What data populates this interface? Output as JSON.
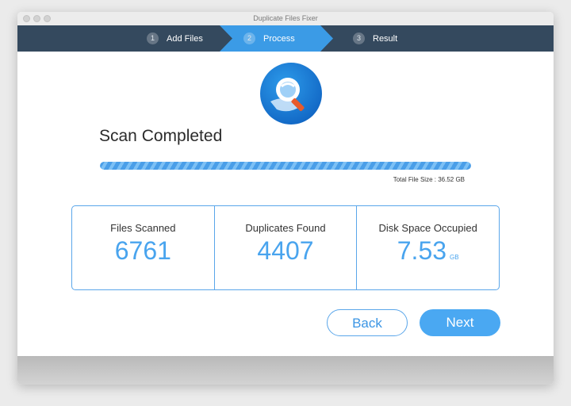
{
  "window": {
    "title": "Duplicate Files Fixer"
  },
  "steps": [
    {
      "num": "1",
      "label": "Add Files",
      "state": "done"
    },
    {
      "num": "2",
      "label": "Process",
      "state": "active"
    },
    {
      "num": "3",
      "label": "Result",
      "state": "pending"
    }
  ],
  "scan": {
    "title": "Scan Completed",
    "progress_percent": 100,
    "total_size": "Total File Size : 36.52 GB"
  },
  "stats": [
    {
      "label": "Files Scanned",
      "value": "6761",
      "unit": ""
    },
    {
      "label": "Duplicates Found",
      "value": "4407",
      "unit": ""
    },
    {
      "label": "Disk Space Occupied",
      "value": "7.53",
      "unit": "GB"
    }
  ],
  "buttons": {
    "back": "Back",
    "next": "Next"
  },
  "colors": {
    "stepbar": "#34495e",
    "active_step": "#3b9be6",
    "accent": "#49a4ee",
    "border": "#5aa6ea"
  },
  "icons": {
    "logo": "magnifier-over-hand-logo"
  }
}
